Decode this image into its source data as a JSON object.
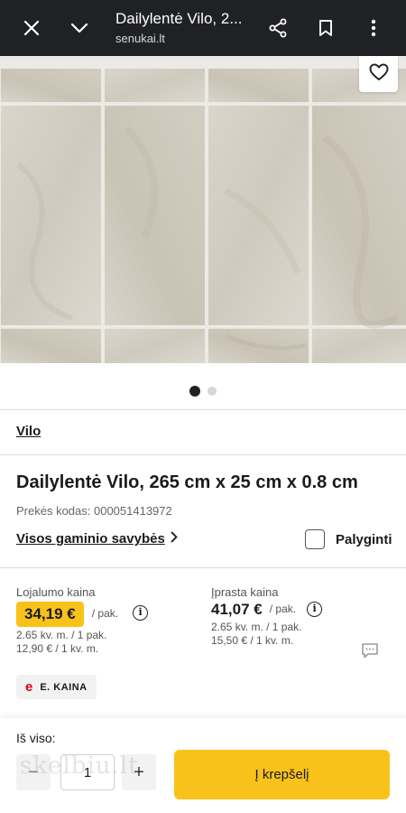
{
  "topbar": {
    "title": "Dailylentė Vilo, 2...",
    "url": "senukai.lt",
    "icons": [
      "close-icon",
      "chevron-down-icon",
      "share-icon",
      "bookmark-icon",
      "more-vertical-icon"
    ]
  },
  "gallery": {
    "favorite_icon": "heart-icon",
    "slide_count": 2,
    "active_slide": 1
  },
  "product": {
    "brand": "Vilo",
    "title": "Dailylentė Vilo, 265 cm x 25 cm x 0.8 cm",
    "sku": "Prekės kodas: 000051413972",
    "all_properties": "Visos gaminio savybės",
    "compare": "Palyginti"
  },
  "pricing": {
    "loyalty_label": "Lojalumo kaina",
    "loyalty_price": "34,19 €",
    "loyalty_unit": "/ pak.",
    "loyalty_sub1": "2.65 kv. m. / 1 pak.",
    "loyalty_sub2": "12,90 € / 1 kv. m.",
    "regular_label": "Įprasta kaina",
    "regular_price": "41,07 €",
    "regular_unit": "/ pak.",
    "regular_sub1": "2.65 kv. m. / 1 pak.",
    "regular_sub2": "15,50 € / 1 kv. m.",
    "info_glyph": "i",
    "echip_letter": "e",
    "echip_text": "E. KAINA"
  },
  "bottom": {
    "total_label": "Iš viso:",
    "minus": "−",
    "quantity": "1",
    "plus": "+",
    "cart_button": "Į krepšelį",
    "watermark": "skelbiu.lt"
  },
  "colors": {
    "accent": "#f9c21b",
    "topbar": "#202124",
    "e_price": "#d0021b"
  }
}
